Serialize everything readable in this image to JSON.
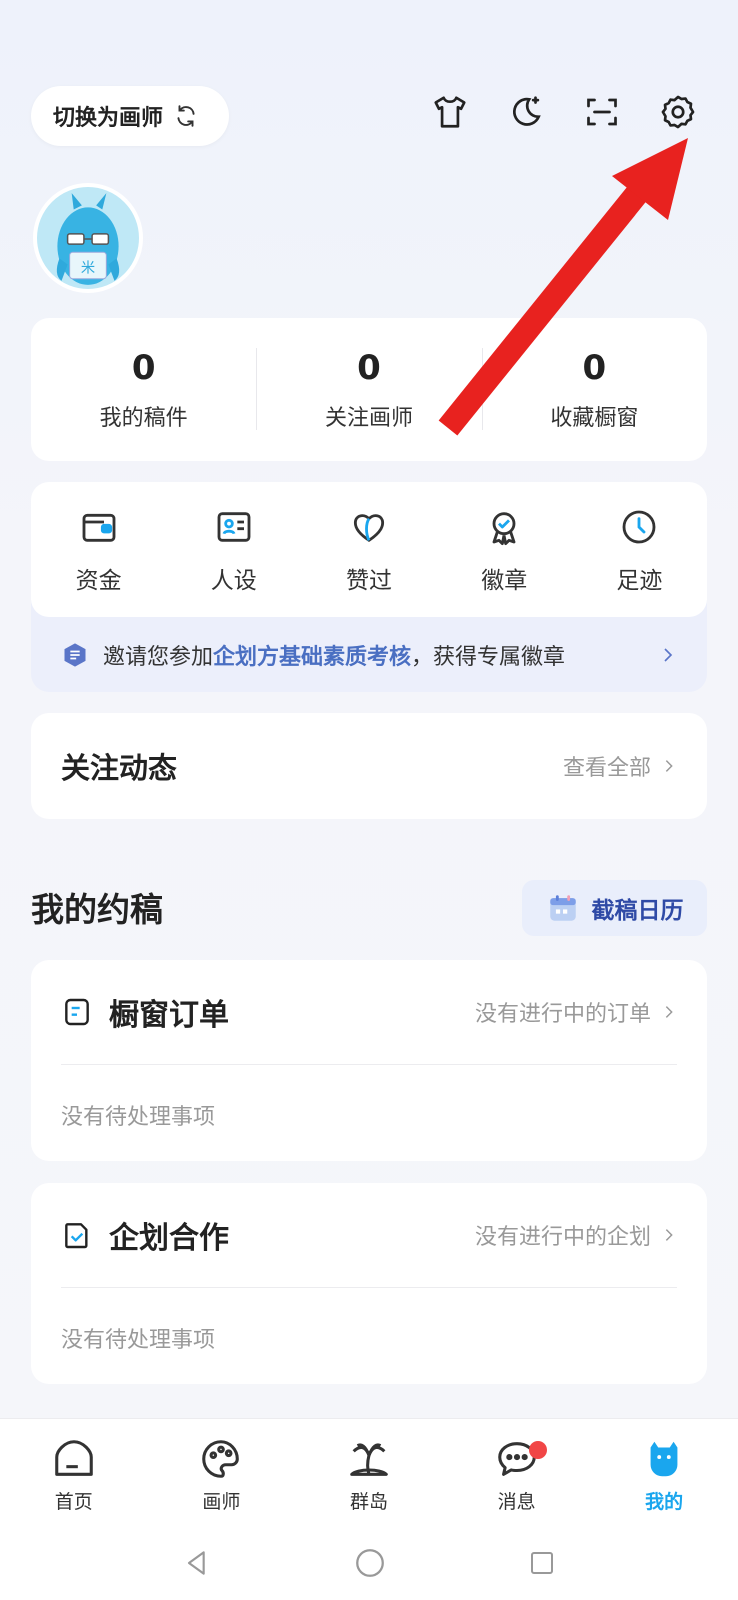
{
  "header": {
    "switch_label": "切换为画师"
  },
  "top_icons": [
    "tshirt-icon",
    "moon-icon",
    "scan-icon",
    "gear-icon"
  ],
  "stats": [
    {
      "value": "0",
      "label": "我的稿件"
    },
    {
      "value": "0",
      "label": "关注画师"
    },
    {
      "value": "0",
      "label": "收藏橱窗"
    }
  ],
  "quick": [
    {
      "icon": "wallet-icon",
      "label": "资金"
    },
    {
      "icon": "id-card-icon",
      "label": "人设"
    },
    {
      "icon": "heart-icon",
      "label": "赞过"
    },
    {
      "icon": "medal-icon",
      "label": "徽章"
    },
    {
      "icon": "clock-icon",
      "label": "足迹"
    }
  ],
  "invite": {
    "prefix": "邀请您参加 ",
    "highlight": "企划方基础素质考核",
    "suffix": "，获得专属徽章"
  },
  "follow": {
    "title": "关注动态",
    "more": "查看全部"
  },
  "commission": {
    "title": "我的约稿",
    "calendar_label": "截稿日历",
    "cards": [
      {
        "icon": "document-icon",
        "title": "橱窗订单",
        "status": "没有进行中的订单",
        "body": "没有待处理事项"
      },
      {
        "icon": "checklist-icon",
        "title": "企划合作",
        "status": "没有进行中的企划",
        "body": "没有待处理事项"
      }
    ]
  },
  "tabbar": [
    {
      "icon": "home-icon",
      "label": "首页",
      "active": false
    },
    {
      "icon": "palette-icon",
      "label": "画师",
      "active": false
    },
    {
      "icon": "island-icon",
      "label": "群岛",
      "active": false
    },
    {
      "icon": "chat-icon",
      "label": "消息",
      "active": false,
      "badge": true
    },
    {
      "icon": "mascot-icon",
      "label": "我的",
      "active": true
    }
  ],
  "accent_color": "#1aa6ee",
  "annotation_color": "#e8221f"
}
